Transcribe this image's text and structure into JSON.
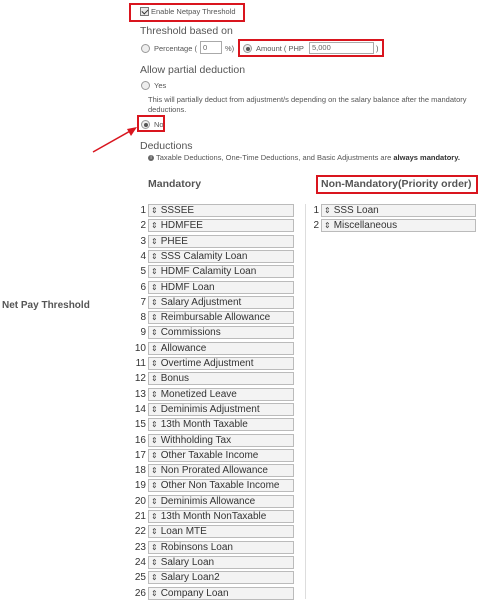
{
  "enable": {
    "label": "Enable Netpay Threshold",
    "checked": true
  },
  "threshold": {
    "heading": "Threshold based on",
    "percentage_label": "Percentage (",
    "percentage_value": "0",
    "percentage_suffix": "%)",
    "amount_label": "Amount ( PHP",
    "amount_value": "5,000",
    "amount_suffix": ")",
    "selected": "amount"
  },
  "partial": {
    "heading": "Allow partial deduction",
    "yes_label": "Yes",
    "yes_note": "This will partially deduct from adjustment/s depending on the salary balance after the mandatory deductions.",
    "no_label": "No",
    "selected": "no"
  },
  "deductions": {
    "heading": "Deductions",
    "info_text": "Taxable Deductions, One-Time Deductions, and Basic Adjustments are",
    "info_bold": "always mandatory."
  },
  "section_label": "Net Pay Threshold",
  "mandatory": {
    "heading": "Mandatory",
    "items": [
      {
        "num": "1",
        "label": "SSSEE"
      },
      {
        "num": "2",
        "label": "HDMFEE"
      },
      {
        "num": "3",
        "label": "PHEE"
      },
      {
        "num": "4",
        "label": "SSS Calamity Loan"
      },
      {
        "num": "5",
        "label": "HDMF Calamity Loan"
      },
      {
        "num": "6",
        "label": "HDMF Loan"
      },
      {
        "num": "7",
        "label": "Salary Adjustment"
      },
      {
        "num": "8",
        "label": "Reimbursable Allowance"
      },
      {
        "num": "9",
        "label": "Commissions"
      },
      {
        "num": "10",
        "label": "Allowance"
      },
      {
        "num": "11",
        "label": "Overtime Adjustment"
      },
      {
        "num": "12",
        "label": "Bonus"
      },
      {
        "num": "13",
        "label": "Monetized Leave"
      },
      {
        "num": "14",
        "label": "Deminimis Adjustment"
      },
      {
        "num": "15",
        "label": "13th Month Taxable"
      },
      {
        "num": "16",
        "label": "Withholding Tax"
      },
      {
        "num": "17",
        "label": "Other Taxable Income"
      },
      {
        "num": "18",
        "label": "Non Prorated Allowance"
      },
      {
        "num": "19",
        "label": "Other Non Taxable Income"
      },
      {
        "num": "20",
        "label": "Deminimis Allowance"
      },
      {
        "num": "21",
        "label": "13th Month NonTaxable"
      },
      {
        "num": "22",
        "label": "Loan MTE"
      },
      {
        "num": "23",
        "label": "Robinsons Loan"
      },
      {
        "num": "24",
        "label": "Salary Loan"
      },
      {
        "num": "25",
        "label": "Salary Loan2"
      },
      {
        "num": "26",
        "label": "Company Loan"
      }
    ]
  },
  "non_mandatory": {
    "heading": "Non-Mandatory(Priority order)",
    "items": [
      {
        "num": "1",
        "label": "SSS Loan"
      },
      {
        "num": "2",
        "label": "Miscellaneous"
      }
    ]
  },
  "drag_handle_glyph": "⇕",
  "colors": {
    "highlight_box": "#d9151e",
    "arrow": "#d9151e"
  }
}
